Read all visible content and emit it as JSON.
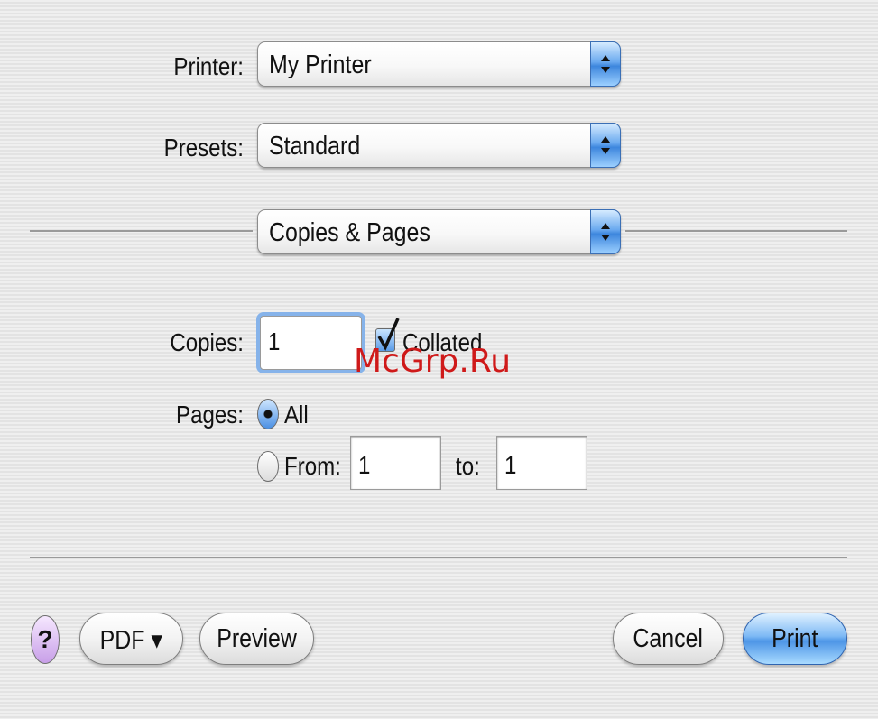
{
  "printer": {
    "label": "Printer:",
    "value": "My Printer"
  },
  "presets": {
    "label": "Presets:",
    "value": "Standard"
  },
  "panel": {
    "value": "Copies & Pages"
  },
  "copies": {
    "label": "Copies:",
    "value": "1",
    "collated_label": "Collated",
    "collated_checked": true
  },
  "pages": {
    "label": "Pages:",
    "all_label": "All",
    "all_selected": true,
    "from_label": "From:",
    "from_value": "1",
    "to_label": "to:",
    "to_value": "1"
  },
  "buttons": {
    "help": "?",
    "pdf": "PDF ▾",
    "preview": "Preview",
    "cancel": "Cancel",
    "print": "Print"
  },
  "watermark": "McGrp.Ru",
  "colors": {
    "accent": "#4d95e6",
    "watermark": "#cf1a1a",
    "help_button": "#c89fe8"
  }
}
